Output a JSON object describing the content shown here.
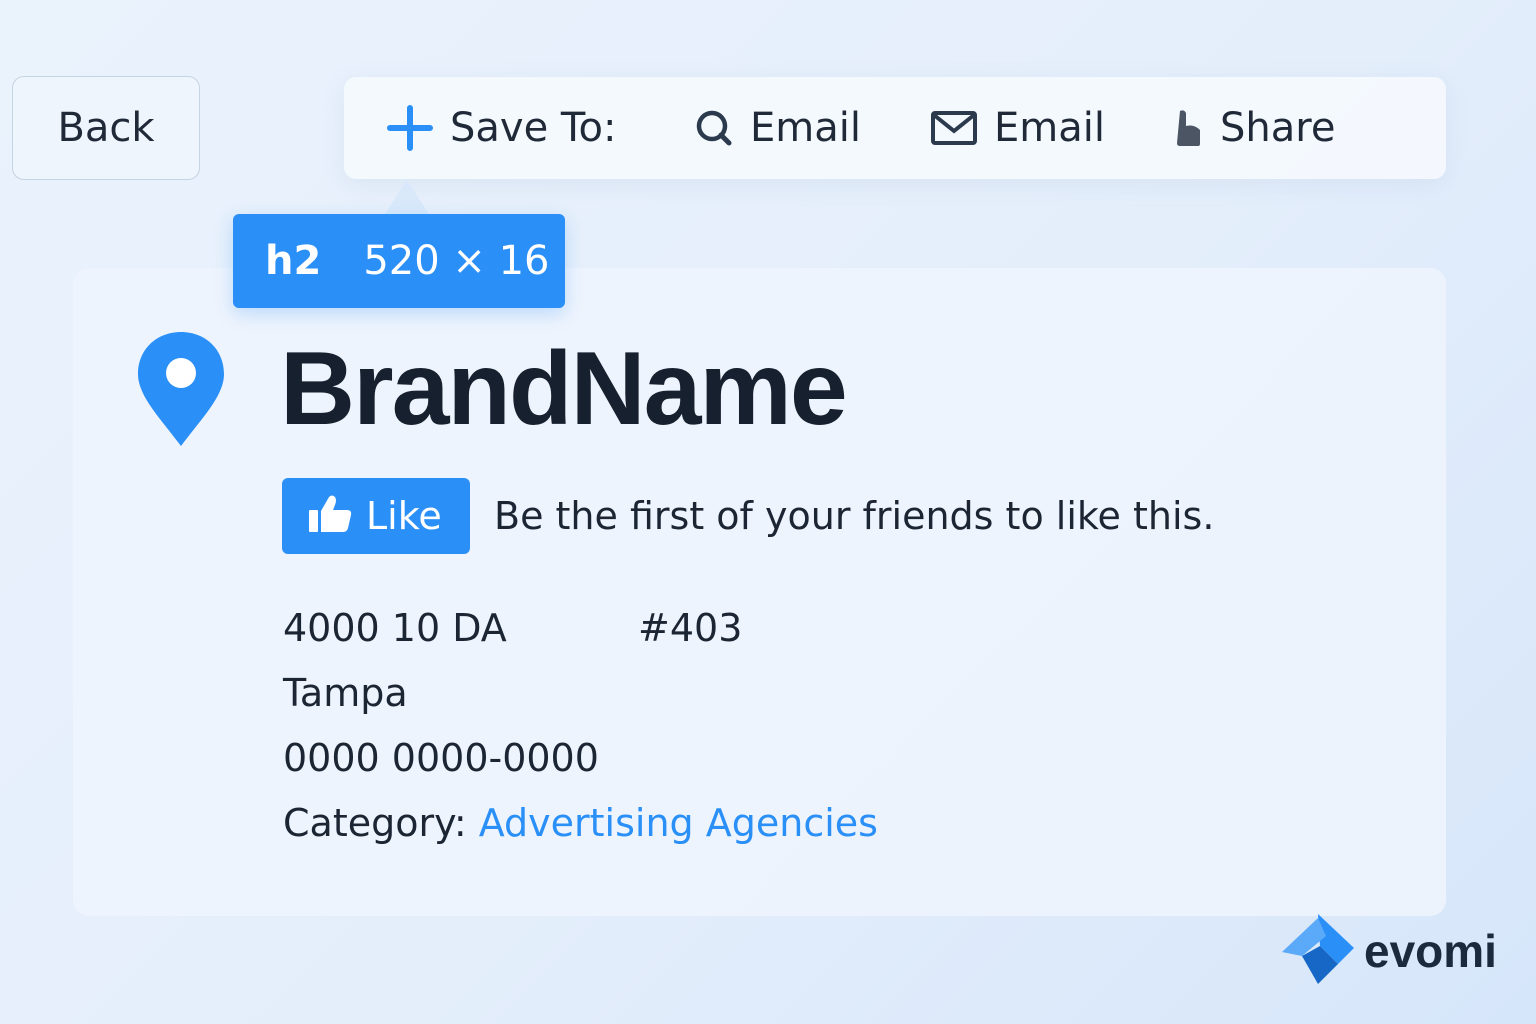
{
  "back_button": {
    "label": "Back"
  },
  "toolbar": {
    "items": [
      {
        "label": "Save To:",
        "icon": "plus-icon"
      },
      {
        "label": "Email",
        "icon": "search-icon"
      },
      {
        "label": "Email",
        "icon": "envelope-icon"
      },
      {
        "label": "Share",
        "icon": "share-icon"
      }
    ]
  },
  "inspector_tooltip": {
    "tag": "h2",
    "dimensions": "520 × 16"
  },
  "listing": {
    "title": "BrandName",
    "like_button_label": "Like",
    "like_prompt": "Be the first of your friends to like this.",
    "address_line1": "4000 10 DA",
    "suite": "#403",
    "city": "Tampa",
    "phone": "0000 0000-0000",
    "category_label": "Category:",
    "category_value": "Advertising Agencies"
  },
  "logo": {
    "text": "evomi"
  },
  "colors": {
    "accent": "#2a8ff7",
    "text": "#1c2533",
    "background": "#e6f0fb"
  }
}
